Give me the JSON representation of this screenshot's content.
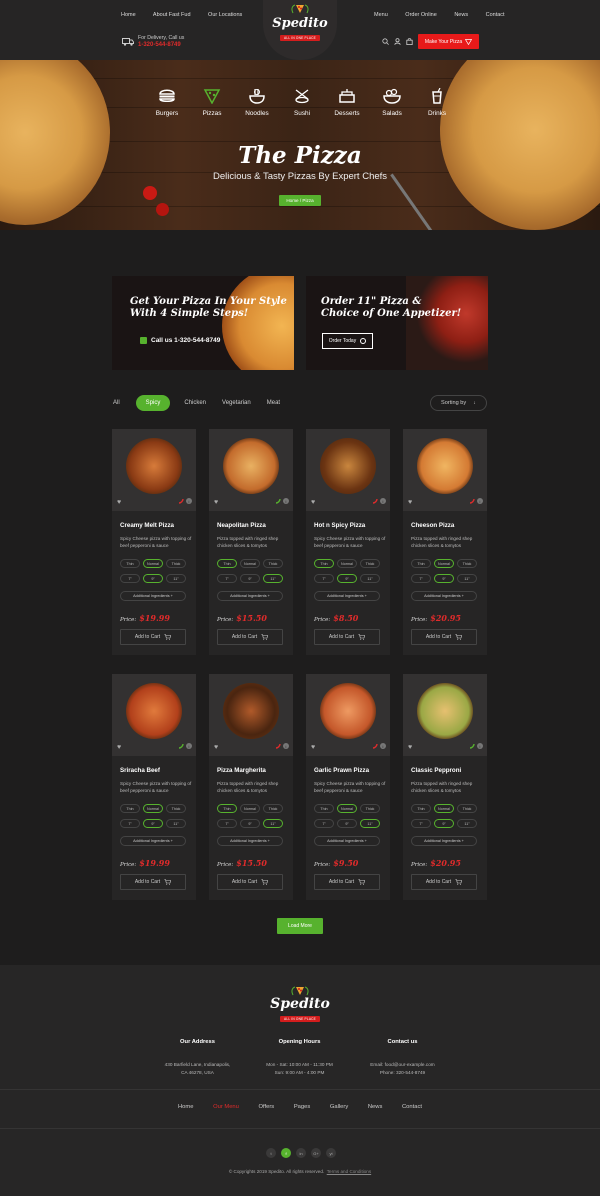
{
  "header": {
    "nav_left": [
      "Home",
      "About Fast Fud",
      "Our Locations"
    ],
    "nav_right": [
      "Menu",
      "Order Online",
      "News",
      "Contact"
    ],
    "logo_text": "Spedito",
    "logo_tagline": "ALL IN ONE PLACE",
    "delivery_label": "For Delivery, Call us",
    "delivery_phone": "1-320-544-8749",
    "cta": "Make Your Pizza",
    "icons": [
      "search-icon",
      "user-icon",
      "bag-icon",
      "truck-icon",
      "pizza-slice-icon"
    ]
  },
  "hero": {
    "categories": [
      "Burgers",
      "Pizzas",
      "Noodles",
      "Sushi",
      "Desserts",
      "Salads",
      "Drinks"
    ],
    "title": "The Pizza",
    "subtitle": "Delicious & Tasty Pizzas By Expert Chefs",
    "breadcrumb": "Home  /  Pizza"
  },
  "promos": [
    {
      "text1": "Get Your Pizza In Your Style",
      "text2": "With 4 Simple Steps!",
      "call": "Call us 1-320-544-8749"
    },
    {
      "text1": "Order 11\" Pizza &",
      "text2": "Choice of One Appetizer!",
      "button": "Order Today"
    }
  ],
  "filters": {
    "items": [
      "All",
      "Spicy",
      "Chicken",
      "Vegetarian",
      "Meat"
    ],
    "active": "Spicy",
    "sort": "Sorting by"
  },
  "products": [
    {
      "name": "Creamy Melt Pizza",
      "desc": "Spicy Cheese pizza with topping of beef pepperoni & sauce",
      "price": "$19.99",
      "crust": "Normal",
      "size": "9\""
    },
    {
      "name": "Neapolitan Pizza",
      "desc": "Pizza topped with ringed shep chicken slices & tomytos",
      "price": "$15.50",
      "crust": "Thin",
      "size": "11\""
    },
    {
      "name": "Hot n Spicy Pizza",
      "desc": "Spicy Cheese pizza with topping of beef pepperoni & sauce",
      "price": "$8.50",
      "crust": "Thin",
      "size": "9\""
    },
    {
      "name": "Cheeson Pizza",
      "desc": "Pizza topped with ringed shep chicken slices & tomytos",
      "price": "$20.95",
      "crust": "Normal",
      "size": "9\""
    },
    {
      "name": "Sriracha Beef",
      "desc": "Spicy Cheese pizza with topping of beef pepperoni & sauce",
      "price": "$19.99",
      "crust": "Normal",
      "size": "9\""
    },
    {
      "name": "Pizza Margherita",
      "desc": "Pizza topped with ringed shep chicken slices & tomytos",
      "price": "$15.50",
      "crust": "Thin",
      "size": "11\""
    },
    {
      "name": "Garlic Prawn Pizza",
      "desc": "Spicy Cheese pizza with topping of beef pepperoni & sauce",
      "price": "$9.50",
      "crust": "Normal",
      "size": "11\""
    },
    {
      "name": "Classic Pepproni",
      "desc": "Pizza topped with ringed shep chicken slices & tomytos",
      "price": "$20.95",
      "crust": "Normal",
      "size": "9\""
    }
  ],
  "card_labels": {
    "crusts": [
      "Thin",
      "Normal",
      "Thick"
    ],
    "sizes": [
      "7\"",
      "9\"",
      "11\""
    ],
    "additional": "Additional Ingredients +",
    "price_label": "Price:",
    "add_to_cart": "Add to Cart"
  },
  "load_more": "Load More",
  "footer": {
    "address_title": "Our Address",
    "address_line1": "430 Barfield Lane, Indianapolis,",
    "address_line2": "CA 46278, USA",
    "hours_title": "Opening Hours",
    "hours_line1": "Mon - Sat: 10:00 AM - 11:30 PM",
    "hours_line2": "Sun: 9:00 AM - 4:00 PM",
    "contact_title": "Contact us",
    "contact_email": "Email: food@our-example.com",
    "contact_phone": "Phone: 320-544-8749",
    "nav": [
      "Home",
      "Our Menu",
      "Offers",
      "Pages",
      "Gallery",
      "News",
      "Contact"
    ],
    "nav_active": "Our Menu",
    "social": [
      "t",
      "f",
      "in",
      "G+",
      "yt"
    ],
    "copyright": "© Copyrights 2019 Spedito. All rights reserved.",
    "terms": "Terms and Conditions"
  },
  "colors": {
    "accent_green": "#57b22e",
    "accent_red": "#e81a1a",
    "bg": "#1e1d1d"
  }
}
